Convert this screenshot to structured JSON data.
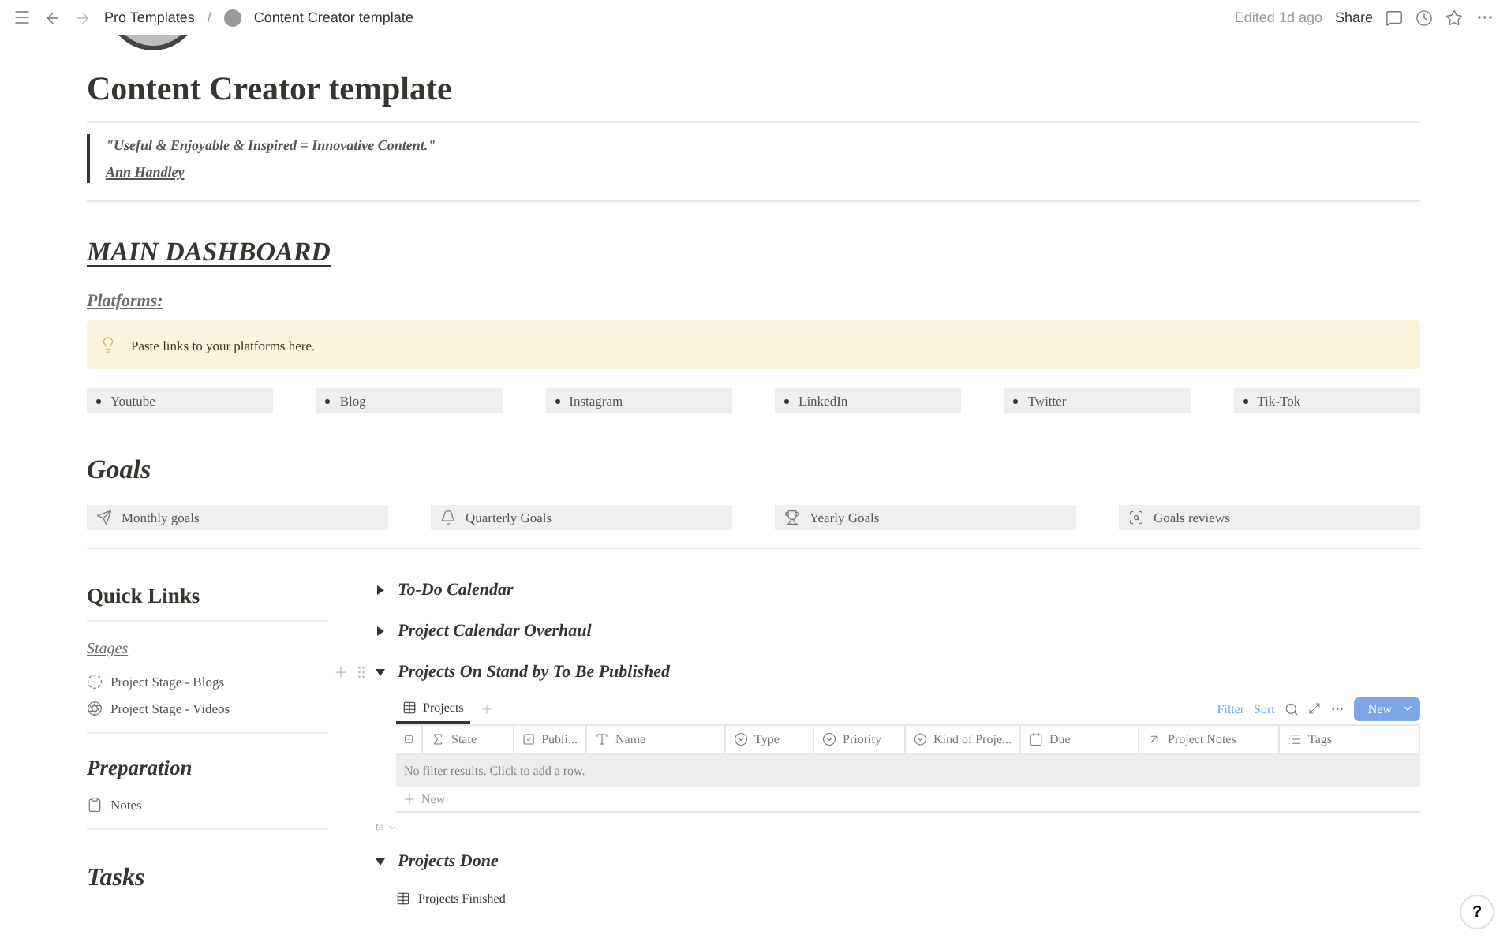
{
  "topbar": {
    "breadcrumbs": [
      "Pro Templates",
      "Content Creator template"
    ],
    "separator": "/",
    "edited": "Edited 1d ago",
    "share": "Share"
  },
  "title": "Content Creator template",
  "quote": {
    "text": "\"Useful & Enjoyable & Inspired = Innovative Content.\"",
    "author": "Ann Handley"
  },
  "dashboard_heading": "MAIN DASHBOARD",
  "platforms": {
    "heading": "Platforms:",
    "callout": "Paste links to your platforms here.",
    "items": [
      "Youtube",
      "Blog",
      "Instagram",
      "LinkedIn",
      "Twitter",
      "Tik-Tok"
    ]
  },
  "goals": {
    "heading": "Goals",
    "items": [
      "Monthly goals",
      "Quarterly Goals",
      "Yearly Goals",
      "Goals reviews"
    ]
  },
  "sidebar": {
    "title": "Quick Links",
    "groups": [
      {
        "kind": "link",
        "heading": "Stages",
        "items": [
          "Project Stage - Blogs",
          "Project Stage - Videos"
        ]
      },
      {
        "kind": "heading",
        "heading": "Preparation",
        "items": [
          "Notes"
        ]
      }
    ],
    "tasks_heading": "Tasks"
  },
  "toggles": [
    {
      "title": "To-Do Calendar",
      "expanded": false
    },
    {
      "title": "Project Calendar Overhaul",
      "expanded": false
    },
    {
      "title": "Projects On Stand by To Be Published",
      "expanded": true,
      "database": {
        "tabs": [
          {
            "label": "Projects",
            "selected": true
          }
        ],
        "filter": "Filter",
        "sort": "Sort",
        "new_button": "New",
        "columns": [
          {
            "kind": "checkbox"
          },
          {
            "kind": "formula",
            "label": "State"
          },
          {
            "kind": "checkbox",
            "label": "Publi..."
          },
          {
            "kind": "title",
            "label": "Name"
          },
          {
            "kind": "select",
            "label": "Type"
          },
          {
            "kind": "select",
            "label": "Priority"
          },
          {
            "kind": "select",
            "label": "Kind of Proje..."
          },
          {
            "kind": "date",
            "label": "Due"
          },
          {
            "kind": "relation",
            "label": "Project Notes"
          },
          {
            "kind": "multiselect",
            "label": "Tags"
          }
        ],
        "empty_message": "No filter results. Click to add a row.",
        "add_row": "New",
        "footer": "te"
      }
    },
    {
      "title": "Projects Done",
      "expanded": true,
      "views": [
        "Projects Finished"
      ]
    }
  ],
  "help_button": "?"
}
